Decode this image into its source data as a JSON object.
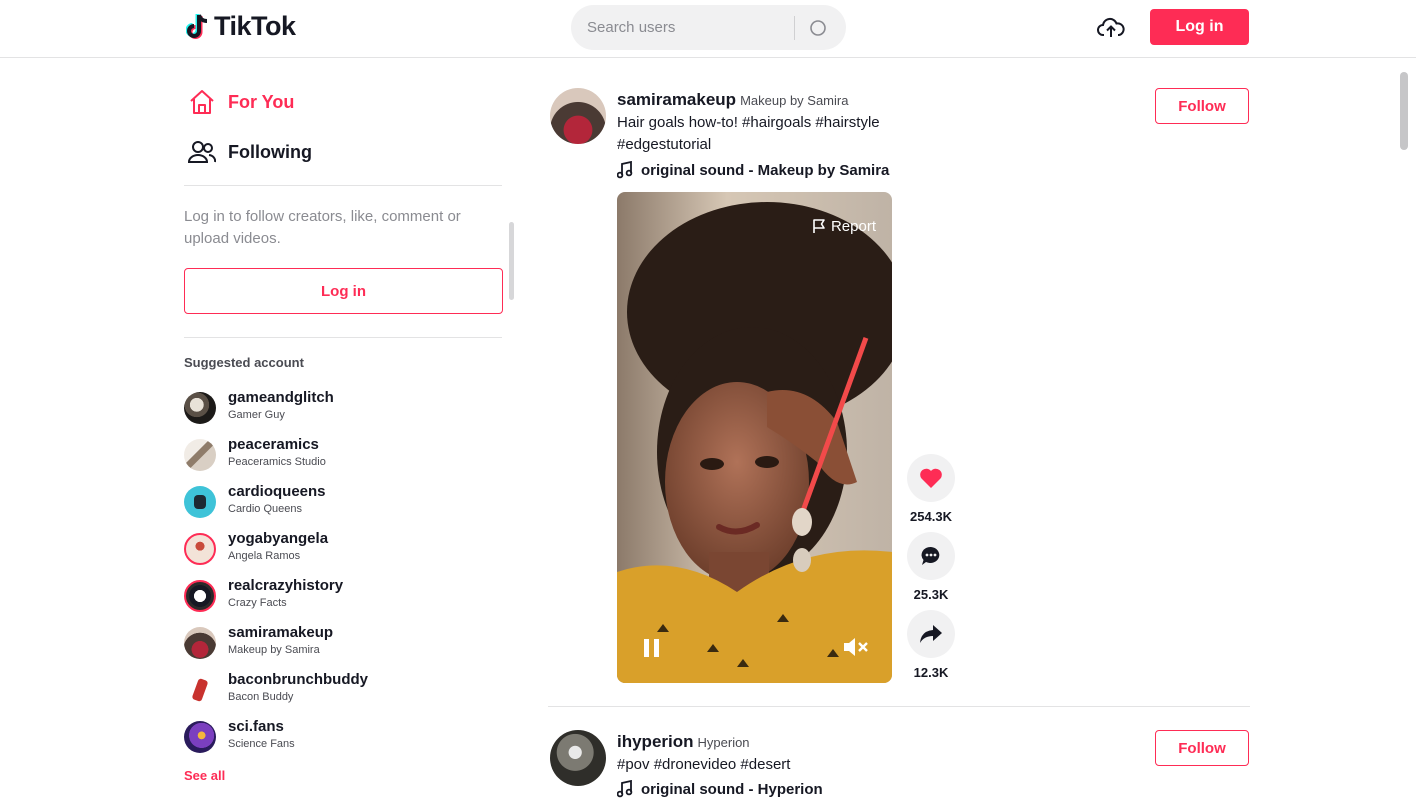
{
  "header": {
    "logo_text": "TikTok",
    "search_placeholder": "Search users",
    "login_label": "Log in"
  },
  "sidebar": {
    "nav": [
      {
        "label": "For You",
        "icon": "home-icon",
        "active": true
      },
      {
        "label": "Following",
        "icon": "users-icon",
        "active": false
      }
    ],
    "login_prompt": "Log in to follow creators, like, comment or upload videos.",
    "login_label": "Log in",
    "suggested_title": "Suggested account",
    "accounts": [
      {
        "username": "gameandglitch",
        "name": "Gamer Guy"
      },
      {
        "username": "peaceramics",
        "name": "Peaceramics Studio"
      },
      {
        "username": "cardioqueens",
        "name": "Cardio Queens"
      },
      {
        "username": "yogabyangela",
        "name": "Angela Ramos"
      },
      {
        "username": "realcrazyhistory",
        "name": "Crazy Facts"
      },
      {
        "username": "samiramakeup",
        "name": "Makeup by Samira"
      },
      {
        "username": "baconbrunchbuddy",
        "name": "Bacon Buddy"
      },
      {
        "username": "sci.fans",
        "name": "Science Fans"
      }
    ],
    "see_all": "See all"
  },
  "feed": {
    "posts": [
      {
        "username": "samiramakeup",
        "nickname": "Makeup by Samira",
        "caption": "Hair goals how-to! #hairgoals #hairstyle #edgestutorial",
        "music": "original sound - Makeup by Samira",
        "follow_label": "Follow",
        "report_label": "Report",
        "likes": "254.3K",
        "comments": "25.3K",
        "shares": "12.3K"
      },
      {
        "username": "ihyperion",
        "nickname": "Hyperion",
        "caption": "#pov #dronevideo #desert",
        "music": "original sound - Hyperion",
        "follow_label": "Follow"
      }
    ]
  },
  "colors": {
    "brand": "#fe2c55",
    "text": "#161823",
    "muted": "#8a8b91"
  }
}
